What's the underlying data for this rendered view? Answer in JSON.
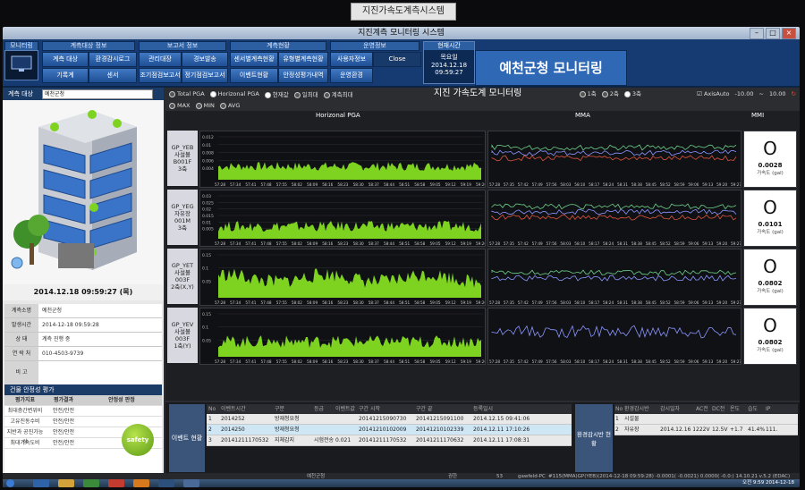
{
  "plate": {
    "label": "지진가속도계측시스템"
  },
  "window": {
    "title": "지진계측 모니터링 시스템"
  },
  "menu": {
    "monitoring": "모니터링",
    "group1": {
      "head": "계측대상 정보",
      "b1": "계측 대상",
      "b2": "환경감시로그",
      "b3": "기록계",
      "b4": "센서"
    },
    "group2": {
      "head": "보고서 정보",
      "b1": "관리대장",
      "b2": "경보발송",
      "b3": "조기점검보고서",
      "b4": "정기점검보고서"
    },
    "group3": {
      "head": "계측현황",
      "b1": "센서별계측현황",
      "b2": "유형별계측현황",
      "b3": "이벤트현황",
      "b4": "안정성평가내역"
    },
    "group4": {
      "head": "운영정보",
      "b1": "사용자정보",
      "b2": "Close",
      "b3": "운영환경"
    },
    "current_time": {
      "head": "현재시간",
      "weekday": "목요일",
      "date": "2014.12.18",
      "time": "09:59:27"
    },
    "brand": "예천군청 모니터링"
  },
  "left": {
    "target_label": "계측 대상",
    "target_value": "예천군청",
    "datetime": "2014.12.18 09:59:27 (목)",
    "info": [
      {
        "k": "계측소명",
        "v": "예천군청"
      },
      {
        "k": "발생시간",
        "v": "2014-12-18 09:59:28"
      },
      {
        "k": "상  태",
        "v": "계측 진행 중"
      },
      {
        "k": "연 락 처",
        "v": "010-4503-9739"
      },
      {
        "k": "비  고",
        "v": ""
      }
    ],
    "safety": {
      "head": "건물 안정성 평가",
      "cols": [
        "평가지표",
        "평가결과",
        "안정성 판정"
      ],
      "rows": [
        {
          "k": "최대층간변위비",
          "v": "안전/안전"
        },
        {
          "k": "고유진동수비",
          "v": "안전/안전"
        },
        {
          "k": "지반과 공진가능성",
          "v": "안전/안전"
        },
        {
          "k": "최대가속도비",
          "v": "안전/안전"
        }
      ],
      "verdict": "safety"
    }
  },
  "controls": {
    "total_pga": "Total PGA",
    "horizonal_pga": "Horizonal PGA",
    "current": "현재값",
    "daily_max": "일최대",
    "cumulative_max": "계측최대",
    "max": "MAX",
    "min": "MIN",
    "avg": "AVG",
    "title": "지진 가속도계 모니터링",
    "axis1": "1축",
    "axis2": "2축",
    "axis3": "3축",
    "axisauto": "AxisAuto",
    "range_min": "-10.00",
    "range_max": "10.00"
  },
  "columns": {
    "pga": "Horizonal PGA",
    "mma": "MMA",
    "mmi": "MMI"
  },
  "rows": [
    {
      "id": "GP_YEB",
      "l2": "사설볼",
      "l3": "B001F",
      "l4": "3축",
      "yticks": [
        "0.012",
        "0.01",
        "0.008",
        "0.006",
        "0.004"
      ],
      "mma_top": "0.007",
      "mmi": "O",
      "mmi_val": "0.0028",
      "unit": "가속도 (gal)"
    },
    {
      "id": "GP_YEG",
      "l2": "자유장",
      "l3": "001M",
      "l4": "3축",
      "yticks": [
        "0.03",
        "0.025",
        "0.02",
        "0.015",
        "0.01",
        "0.005"
      ],
      "mma_top": "0.024",
      "mmi": "O",
      "mmi_val": "0.0101",
      "unit": "가속도 (gal)"
    },
    {
      "id": "GP_YET",
      "l2": "사설볼",
      "l3": "003F",
      "l4": "2축(X,Y)",
      "yticks": [
        "0.15",
        "0.1",
        "0.05"
      ],
      "mma_top": "0.128",
      "mmi": "O",
      "mmi_val": "0.0802",
      "unit": "가속도 (gal)"
    },
    {
      "id": "GP_YEV",
      "l2": "사설볼",
      "l3": "003F",
      "l4": "1축(Y)",
      "yticks": [
        "0.15",
        "0.1",
        "0.05"
      ],
      "mma_top": "0.057",
      "mmi": "O",
      "mmi_val": "0.0802",
      "unit": "가속도 (gal)"
    }
  ],
  "xticks_pga": [
    "57:28",
    "57:34",
    "57:41",
    "57:48",
    "57:55",
    "58:02",
    "58:09",
    "58:16",
    "58:23",
    "58:30",
    "58:37",
    "58:44",
    "58:51",
    "58:58",
    "59:05",
    "59:12",
    "59:19",
    "59:26"
  ],
  "xticks_mma": [
    "57:28",
    "57:35",
    "57:42",
    "57:49",
    "57:56",
    "58:03",
    "58:10",
    "58:17",
    "58:24",
    "58:31",
    "58:38",
    "58:45",
    "58:52",
    "58:59",
    "59:06",
    "59:13",
    "59:20",
    "59:27"
  ],
  "events": {
    "label": "이벤트 현황",
    "cols": [
      "No",
      "이벤트시간",
      "구분",
      "등급",
      "이벤트값",
      "구간 시작",
      "구간 끝",
      "등록일시"
    ],
    "rows": [
      [
        "1",
        "2014252",
        "방재청요청",
        "",
        "",
        "20141215090730",
        "20141215091100",
        "2014.12.15 09:41:06"
      ],
      [
        "2",
        "2014250",
        "방재청요청",
        "",
        "",
        "20141210102009",
        "20141210102339",
        "2014.12.11 17:10:26"
      ],
      [
        "3",
        "20141211170532",
        "지체감지",
        "시험전송",
        "0.021",
        "20141211170532",
        "20141211170632",
        "2014.12.11 17:08:31"
      ]
    ]
  },
  "env": {
    "label": "환경감시반 현황",
    "cols": [
      "No",
      "환경감시반",
      "감시일자",
      "AC전",
      "DC전",
      "온도",
      "습도",
      "IP"
    ],
    "rows": [
      [
        "1",
        "시설물",
        "",
        "",
        "",
        "",
        "",
        ""
      ],
      [
        "2",
        "자유장",
        "2014.12.16 17:00",
        "222V",
        "12.5V",
        "+1.7",
        "41.4%",
        "111."
      ]
    ]
  },
  "status": {
    "s1": "예천군청",
    "s2": "권한",
    "s3": "53",
    "s4": "gawfeld-PC",
    "s5": "#115(MMA)GP(YEB)(2014-12-18 09:59:28) -0.0001( -0.0021) 0.0000( -0.0:) 14.10.21 v.5.2 (EDAC)"
  },
  "clock": {
    "time": "오전 9:59",
    "date": "2014-12-18"
  },
  "colors": {
    "chart_fill": "#7ed321",
    "navy": "#163b72",
    "mma_green": "#6fd18b",
    "mma_red": "#e0553c",
    "mma_blue": "#8b95ff"
  }
}
